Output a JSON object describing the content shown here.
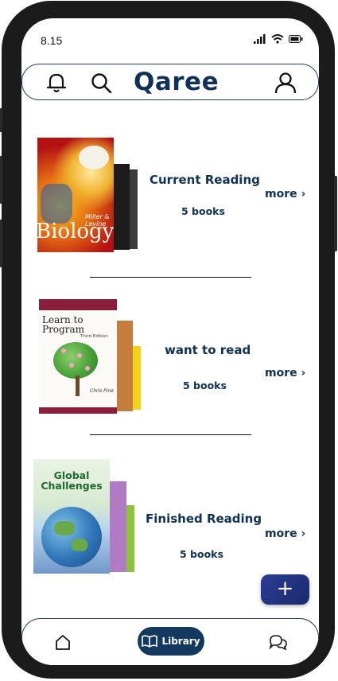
{
  "status_bar": {
    "time": "8.15"
  },
  "header": {
    "app_title": "Qaree"
  },
  "shelves": [
    {
      "title": "Current Reading",
      "count": "5 books",
      "more": "more ›",
      "cover_title": "Biology",
      "cover_author": "Miller & Levine"
    },
    {
      "title": "want to read",
      "count": "5 books",
      "more": "more ›",
      "cover_title": "Learn to Program",
      "cover_edition": "Third Edition",
      "cover_author": "Chris Pine"
    },
    {
      "title": "Finished Reading",
      "count": "5 books",
      "more": "more ›",
      "cover_title": "Global Challenges"
    }
  ],
  "fab": {
    "label": "+"
  },
  "bottom_nav": {
    "library_label": "Library"
  },
  "colors": {
    "brand": "#0f3157",
    "fab": "#2c3d96",
    "pill": "#133a5e"
  }
}
